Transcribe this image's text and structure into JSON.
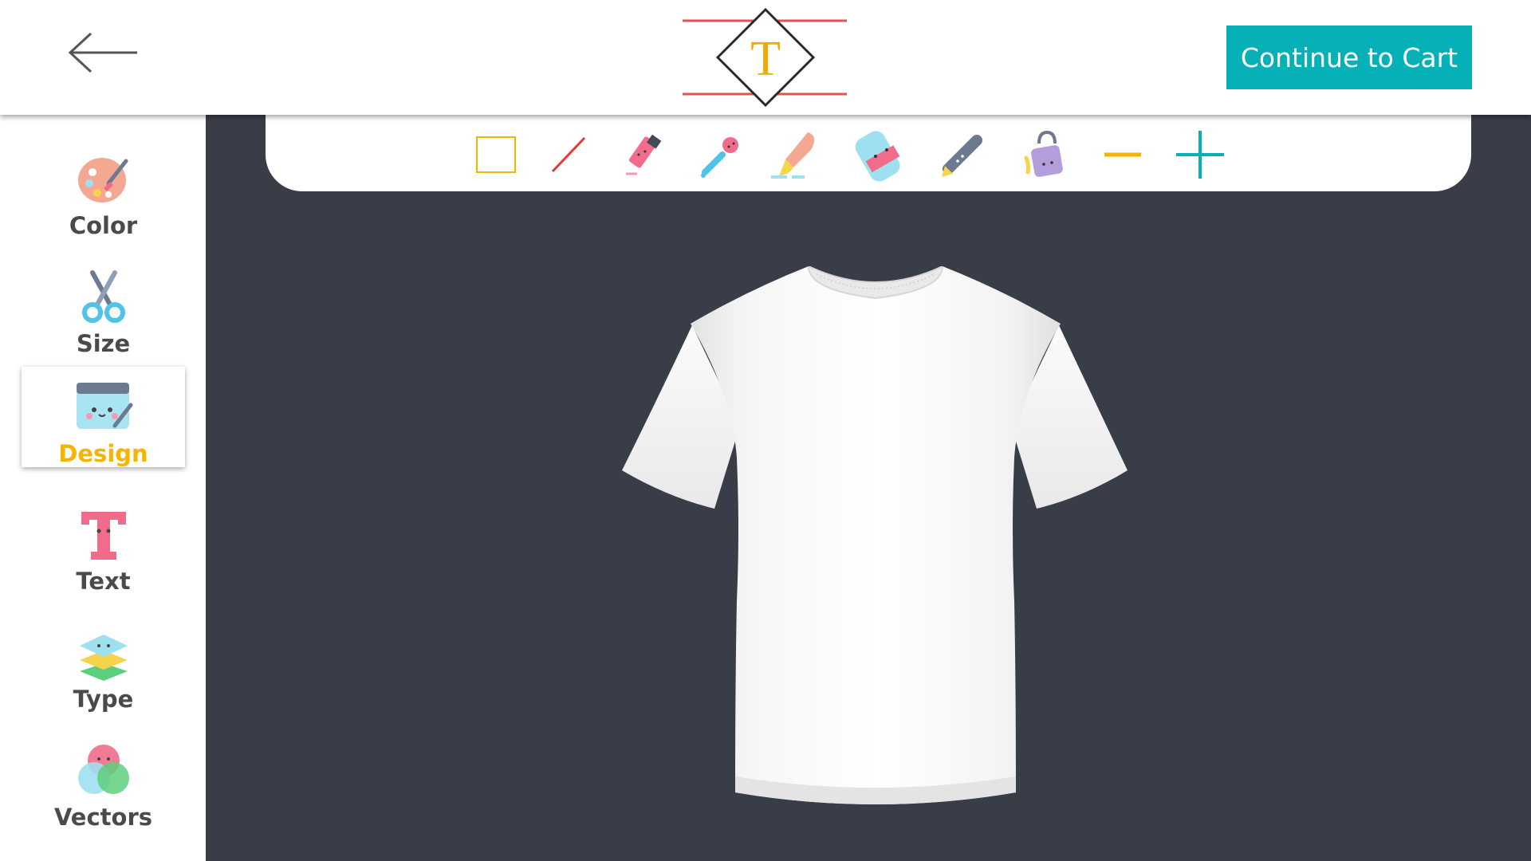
{
  "header": {
    "back_icon": "arrow-left-icon",
    "logo_letter": "T",
    "cart_label": "Continue to Cart",
    "cart_color": "#05b1b7"
  },
  "sidebar": {
    "items": [
      {
        "label": "Color",
        "icon": "palette-icon",
        "active": false
      },
      {
        "label": "Size",
        "icon": "scissors-icon",
        "active": false
      },
      {
        "label": "Design",
        "icon": "design-board-icon",
        "active": true
      },
      {
        "label": "Text",
        "icon": "text-icon",
        "active": false
      },
      {
        "label": "Type",
        "icon": "layers-icon",
        "active": false
      },
      {
        "label": "Vectors",
        "icon": "venn-circles-icon",
        "active": false
      }
    ],
    "active_color": "#f5b400"
  },
  "toolbar": {
    "tools": [
      "rectangle-icon",
      "line-icon",
      "marker-icon",
      "dropper-icon",
      "brush-icon",
      "eraser-icon",
      "pen-icon",
      "paint-bucket-icon",
      "zoom-out-icon",
      "zoom-in-icon"
    ]
  },
  "canvas": {
    "background": "#383d47",
    "product": "white-tshirt"
  }
}
